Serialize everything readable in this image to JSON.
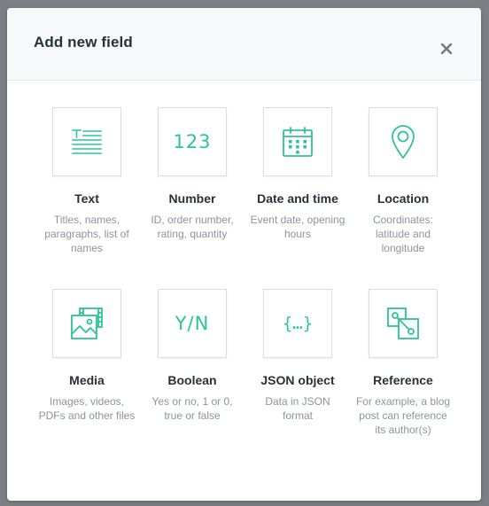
{
  "modal": {
    "title": "Add new field",
    "close_label": "Close"
  },
  "colors": {
    "accent": "#2cc592",
    "title_text": "#2a3039",
    "muted_text": "#8b949e",
    "tile_border": "#d8dde1",
    "header_bg": "#f7f9fa",
    "backdrop": "#7c7f83"
  },
  "field_types": [
    {
      "label": "Text",
      "icon": "text-lines-icon",
      "desc": "Titles, names, paragraphs, list of names"
    },
    {
      "label": "Number",
      "icon": "number-icon",
      "icon_text": "123",
      "desc": "ID, order number, rating, quantity"
    },
    {
      "label": "Date and time",
      "icon": "calendar-icon",
      "desc": "Event date, opening hours"
    },
    {
      "label": "Location",
      "icon": "map-pin-icon",
      "desc": "Coordinates: latitude and longitude"
    },
    {
      "label": "Media",
      "icon": "media-image-icon",
      "desc": "Images, videos, PDFs and other files"
    },
    {
      "label": "Boolean",
      "icon": "boolean-icon",
      "icon_text": "Y/N",
      "desc": "Yes or no, 1 or 0, true or false"
    },
    {
      "label": "JSON object",
      "icon": "json-braces-icon",
      "icon_text": "{…}",
      "desc": "Data in JSON format"
    },
    {
      "label": "Reference",
      "icon": "reference-link-icon",
      "desc": "For example, a blog post can reference its author(s)"
    }
  ]
}
